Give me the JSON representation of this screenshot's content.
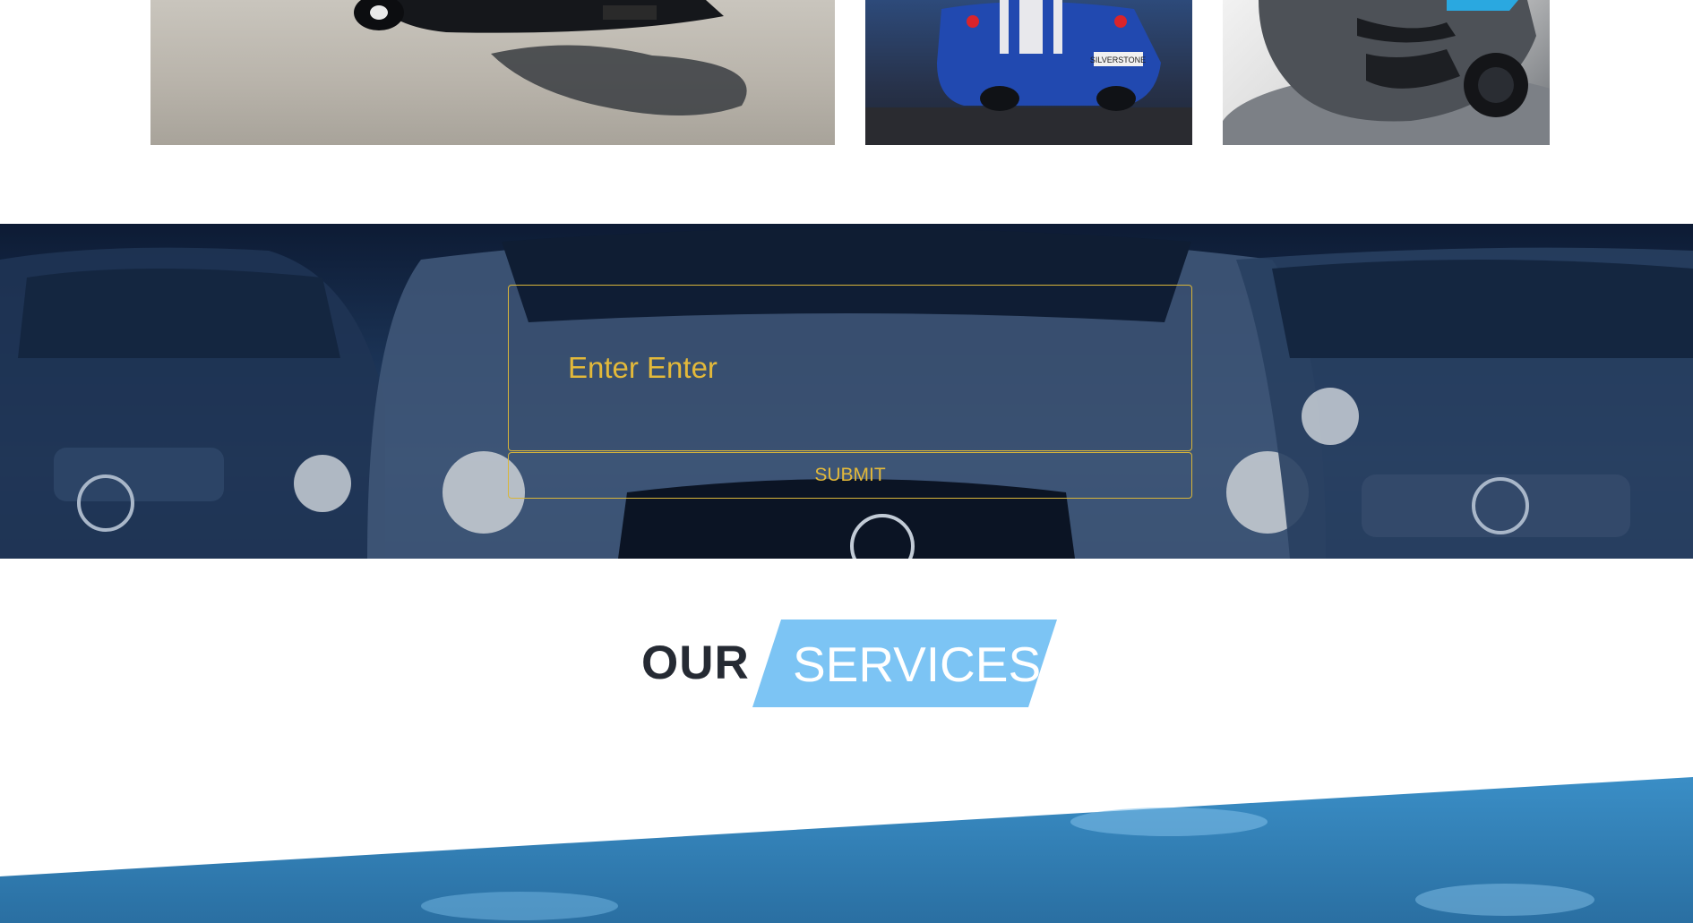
{
  "gallery": {
    "photos": [
      {
        "icon": "car-photo"
      },
      {
        "icon": "race-car-photo",
        "plate_text": "SILVERSTONE"
      },
      {
        "icon": "sports-car-photo"
      }
    ]
  },
  "subscribe": {
    "input_placeholder": "Enter Enter",
    "submit_label": "SUBMIT",
    "accent_color": "#e3b93a"
  },
  "services_heading": {
    "word_1": "OUR",
    "word_2": "SERVICES",
    "tag_color": "#7cc4f4"
  },
  "colors": {
    "band_blue": "#2f7bb0",
    "hero_navy": "#1c3558"
  }
}
